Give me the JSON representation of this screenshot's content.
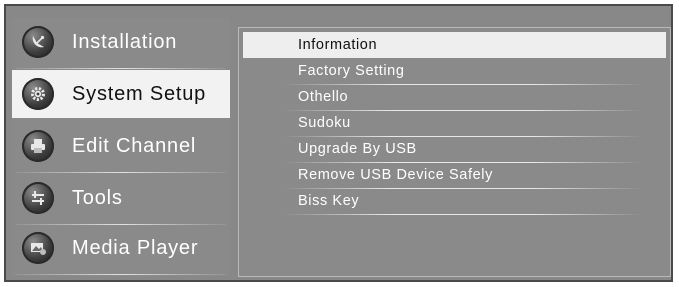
{
  "left_menu": {
    "items": [
      {
        "label": "Installation",
        "icon": "satellite-dish-icon",
        "selected": false
      },
      {
        "label": "System Setup",
        "icon": "gear-icon",
        "selected": true
      },
      {
        "label": "Edit Channel",
        "icon": "printer-icon",
        "selected": false
      },
      {
        "label": "Tools",
        "icon": "tools-icon",
        "selected": false
      },
      {
        "label": "Media Player",
        "icon": "media-icon",
        "selected": false
      }
    ]
  },
  "submenu": {
    "items": [
      {
        "label": "Information",
        "selected": true
      },
      {
        "label": "Factory Setting",
        "selected": false
      },
      {
        "label": "Othello",
        "selected": false
      },
      {
        "label": "Sudoku",
        "selected": false
      },
      {
        "label": "Upgrade By USB",
        "selected": false
      },
      {
        "label": "Remove USB Device Safely",
        "selected": false
      },
      {
        "label": "Biss Key",
        "selected": false
      }
    ]
  },
  "colors": {
    "panel_bg": "#888888",
    "selected_bg": "#f2f2f2",
    "text": "#ffffff",
    "selected_text": "#111111"
  }
}
